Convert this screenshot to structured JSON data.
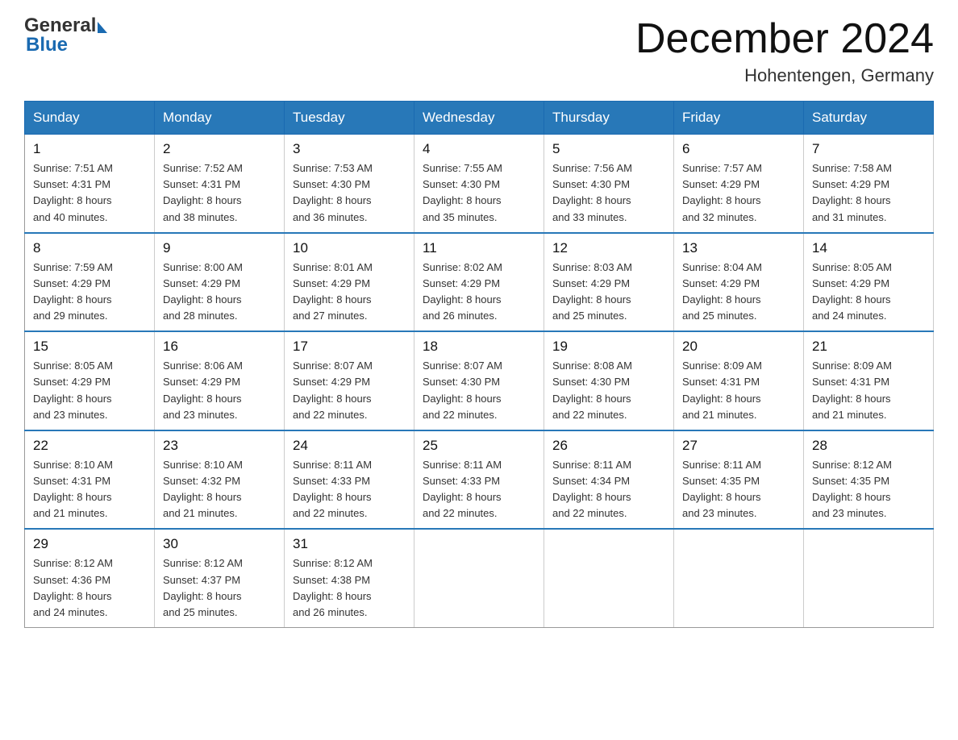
{
  "header": {
    "logo_general": "General",
    "logo_blue": "Blue",
    "title": "December 2024",
    "subtitle": "Hohentengen, Germany"
  },
  "days_of_week": [
    "Sunday",
    "Monday",
    "Tuesday",
    "Wednesday",
    "Thursday",
    "Friday",
    "Saturday"
  ],
  "weeks": [
    [
      {
        "day": "1",
        "sunrise": "7:51 AM",
        "sunset": "4:31 PM",
        "daylight": "8 hours and 40 minutes."
      },
      {
        "day": "2",
        "sunrise": "7:52 AM",
        "sunset": "4:31 PM",
        "daylight": "8 hours and 38 minutes."
      },
      {
        "day": "3",
        "sunrise": "7:53 AM",
        "sunset": "4:30 PM",
        "daylight": "8 hours and 36 minutes."
      },
      {
        "day": "4",
        "sunrise": "7:55 AM",
        "sunset": "4:30 PM",
        "daylight": "8 hours and 35 minutes."
      },
      {
        "day": "5",
        "sunrise": "7:56 AM",
        "sunset": "4:30 PM",
        "daylight": "8 hours and 33 minutes."
      },
      {
        "day": "6",
        "sunrise": "7:57 AM",
        "sunset": "4:29 PM",
        "daylight": "8 hours and 32 minutes."
      },
      {
        "day": "7",
        "sunrise": "7:58 AM",
        "sunset": "4:29 PM",
        "daylight": "8 hours and 31 minutes."
      }
    ],
    [
      {
        "day": "8",
        "sunrise": "7:59 AM",
        "sunset": "4:29 PM",
        "daylight": "8 hours and 29 minutes."
      },
      {
        "day": "9",
        "sunrise": "8:00 AM",
        "sunset": "4:29 PM",
        "daylight": "8 hours and 28 minutes."
      },
      {
        "day": "10",
        "sunrise": "8:01 AM",
        "sunset": "4:29 PM",
        "daylight": "8 hours and 27 minutes."
      },
      {
        "day": "11",
        "sunrise": "8:02 AM",
        "sunset": "4:29 PM",
        "daylight": "8 hours and 26 minutes."
      },
      {
        "day": "12",
        "sunrise": "8:03 AM",
        "sunset": "4:29 PM",
        "daylight": "8 hours and 25 minutes."
      },
      {
        "day": "13",
        "sunrise": "8:04 AM",
        "sunset": "4:29 PM",
        "daylight": "8 hours and 25 minutes."
      },
      {
        "day": "14",
        "sunrise": "8:05 AM",
        "sunset": "4:29 PM",
        "daylight": "8 hours and 24 minutes."
      }
    ],
    [
      {
        "day": "15",
        "sunrise": "8:05 AM",
        "sunset": "4:29 PM",
        "daylight": "8 hours and 23 minutes."
      },
      {
        "day": "16",
        "sunrise": "8:06 AM",
        "sunset": "4:29 PM",
        "daylight": "8 hours and 23 minutes."
      },
      {
        "day": "17",
        "sunrise": "8:07 AM",
        "sunset": "4:29 PM",
        "daylight": "8 hours and 22 minutes."
      },
      {
        "day": "18",
        "sunrise": "8:07 AM",
        "sunset": "4:30 PM",
        "daylight": "8 hours and 22 minutes."
      },
      {
        "day": "19",
        "sunrise": "8:08 AM",
        "sunset": "4:30 PM",
        "daylight": "8 hours and 22 minutes."
      },
      {
        "day": "20",
        "sunrise": "8:09 AM",
        "sunset": "4:31 PM",
        "daylight": "8 hours and 21 minutes."
      },
      {
        "day": "21",
        "sunrise": "8:09 AM",
        "sunset": "4:31 PM",
        "daylight": "8 hours and 21 minutes."
      }
    ],
    [
      {
        "day": "22",
        "sunrise": "8:10 AM",
        "sunset": "4:31 PM",
        "daylight": "8 hours and 21 minutes."
      },
      {
        "day": "23",
        "sunrise": "8:10 AM",
        "sunset": "4:32 PM",
        "daylight": "8 hours and 21 minutes."
      },
      {
        "day": "24",
        "sunrise": "8:11 AM",
        "sunset": "4:33 PM",
        "daylight": "8 hours and 22 minutes."
      },
      {
        "day": "25",
        "sunrise": "8:11 AM",
        "sunset": "4:33 PM",
        "daylight": "8 hours and 22 minutes."
      },
      {
        "day": "26",
        "sunrise": "8:11 AM",
        "sunset": "4:34 PM",
        "daylight": "8 hours and 22 minutes."
      },
      {
        "day": "27",
        "sunrise": "8:11 AM",
        "sunset": "4:35 PM",
        "daylight": "8 hours and 23 minutes."
      },
      {
        "day": "28",
        "sunrise": "8:12 AM",
        "sunset": "4:35 PM",
        "daylight": "8 hours and 23 minutes."
      }
    ],
    [
      {
        "day": "29",
        "sunrise": "8:12 AM",
        "sunset": "4:36 PM",
        "daylight": "8 hours and 24 minutes."
      },
      {
        "day": "30",
        "sunrise": "8:12 AM",
        "sunset": "4:37 PM",
        "daylight": "8 hours and 25 minutes."
      },
      {
        "day": "31",
        "sunrise": "8:12 AM",
        "sunset": "4:38 PM",
        "daylight": "8 hours and 26 minutes."
      },
      null,
      null,
      null,
      null
    ]
  ],
  "labels": {
    "sunrise": "Sunrise:",
    "sunset": "Sunset:",
    "daylight": "Daylight:"
  }
}
